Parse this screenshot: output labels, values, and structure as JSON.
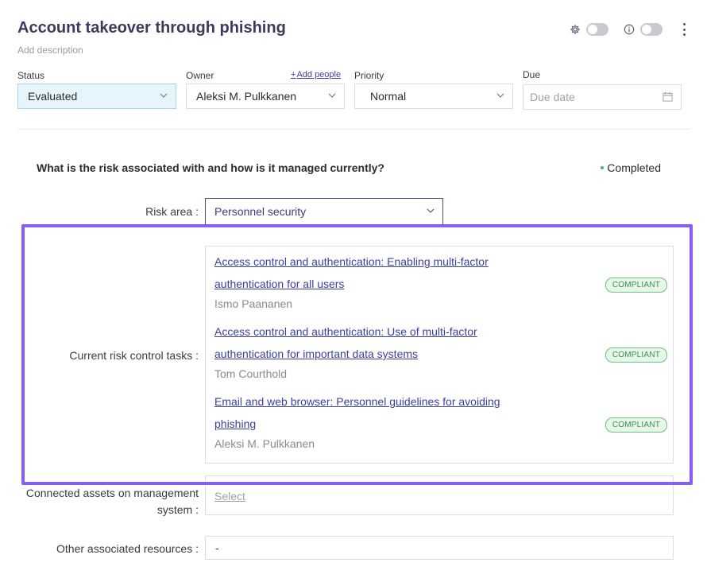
{
  "header": {
    "title": "Account takeover through phishing",
    "description_placeholder": "Add description"
  },
  "top_icons": [
    "gear-icon",
    "info-icon",
    "kebab-menu-icon"
  ],
  "fields": {
    "status": {
      "label": "Status",
      "value": "Evaluated"
    },
    "owner": {
      "label": "Owner",
      "value": "Aleksi M. Pulkkanen",
      "add_people_plus": "+",
      "add_people": "Add people"
    },
    "priority": {
      "label": "Priority",
      "value": "Normal"
    },
    "due": {
      "label": "Due",
      "placeholder": "Due date"
    }
  },
  "section": {
    "question": "What is the risk associated with and how is it managed currently?",
    "status": "Completed"
  },
  "risk_area": {
    "label": "Risk area :",
    "value": "Personnel security"
  },
  "risk_control": {
    "label": "Current risk control tasks :",
    "tasks": [
      {
        "title_line1": "Access control and authentication: Enabling multi-factor",
        "title_line2": "authentication for all users",
        "owner": "Ismo Paananen",
        "status": "COMPLIANT"
      },
      {
        "title_line1": "Access control and authentication: Use of multi-factor",
        "title_line2": "authentication for important data systems",
        "owner": "Tom Courthold",
        "status": "COMPLIANT"
      },
      {
        "title_line1": "Email and web browser: Personnel guidelines for avoiding",
        "title_line2": "phishing",
        "owner": "Aleksi M. Pulkkanen",
        "status": "COMPLIANT"
      }
    ]
  },
  "connected_assets": {
    "label_line1": "Connected assets on management",
    "label_line2": "system :",
    "placeholder": "Select"
  },
  "other_resources": {
    "label": "Other associated resources :",
    "value": "-"
  },
  "colors": {
    "accent": "#3b3f9e",
    "highlight": "#8a5cf6",
    "compliant": "#3d8a53",
    "status_bg": "#e6f4fb"
  }
}
